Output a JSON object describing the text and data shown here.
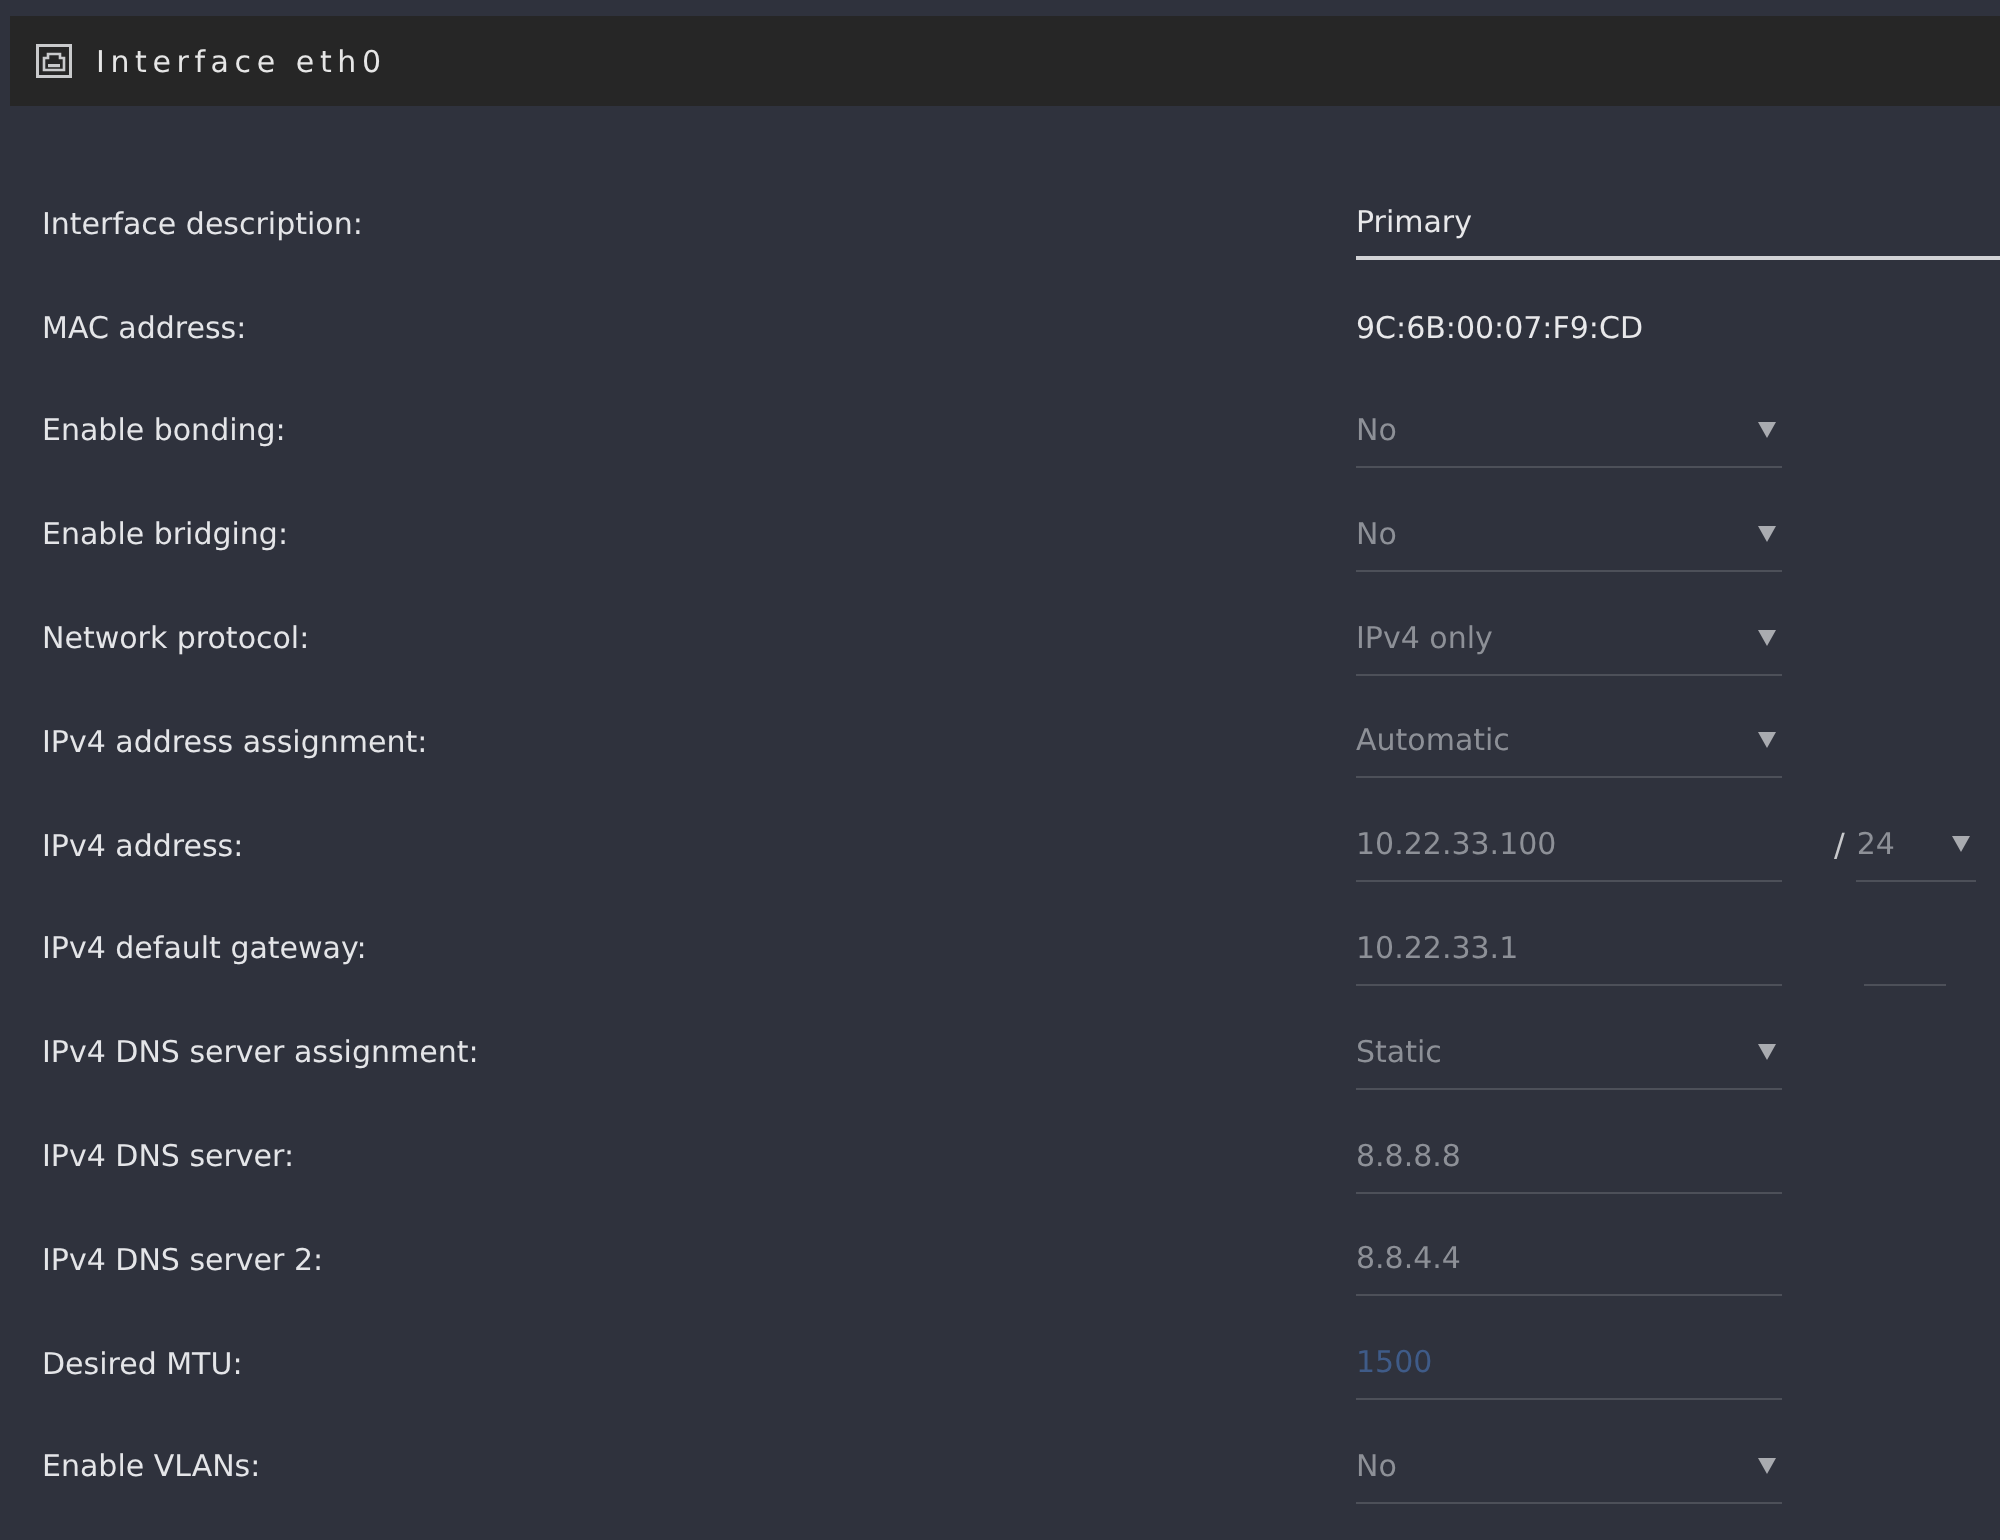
{
  "header": {
    "title": "Interface eth0"
  },
  "fields": [
    {
      "label": "Interface description:",
      "kind": "text",
      "value": "Primary",
      "disabled": false
    },
    {
      "label": "MAC address:",
      "kind": "static",
      "value": "9C:6B:00:07:F9:CD",
      "disabled": false
    },
    {
      "label": "Enable bonding:",
      "kind": "select",
      "value": "No",
      "disabled": true
    },
    {
      "label": "Enable bridging:",
      "kind": "select",
      "value": "No",
      "disabled": true
    },
    {
      "label": "Network protocol:",
      "kind": "select",
      "value": "IPv4 only",
      "disabled": true
    },
    {
      "label": "IPv4 address assignment:",
      "kind": "select",
      "value": "Automatic",
      "disabled": true
    },
    {
      "label": "IPv4 address:",
      "kind": "input",
      "value": "10.22.33.100",
      "disabled": true,
      "suffix": {
        "separator": "/",
        "kind": "select",
        "value": "24",
        "disabled": true
      }
    },
    {
      "label": "IPv4 default gateway:",
      "kind": "input",
      "value": "10.22.33.1",
      "disabled": true,
      "suffix": {
        "kind": "input",
        "disabled": true
      }
    },
    {
      "label": "IPv4 DNS server assignment:",
      "kind": "select",
      "value": "Static",
      "disabled": true
    },
    {
      "label": "IPv4 DNS server:",
      "kind": "input",
      "value": "8.8.8.8",
      "disabled": true
    },
    {
      "label": "IPv4 DNS server 2:",
      "kind": "input",
      "value": "8.8.4.4",
      "disabled": true
    },
    {
      "label": "Desired MTU:",
      "kind": "input",
      "placeholder": "1500",
      "disabled": true
    },
    {
      "label": "Enable VLANs:",
      "kind": "select",
      "value": "No",
      "disabled": true
    }
  ]
}
